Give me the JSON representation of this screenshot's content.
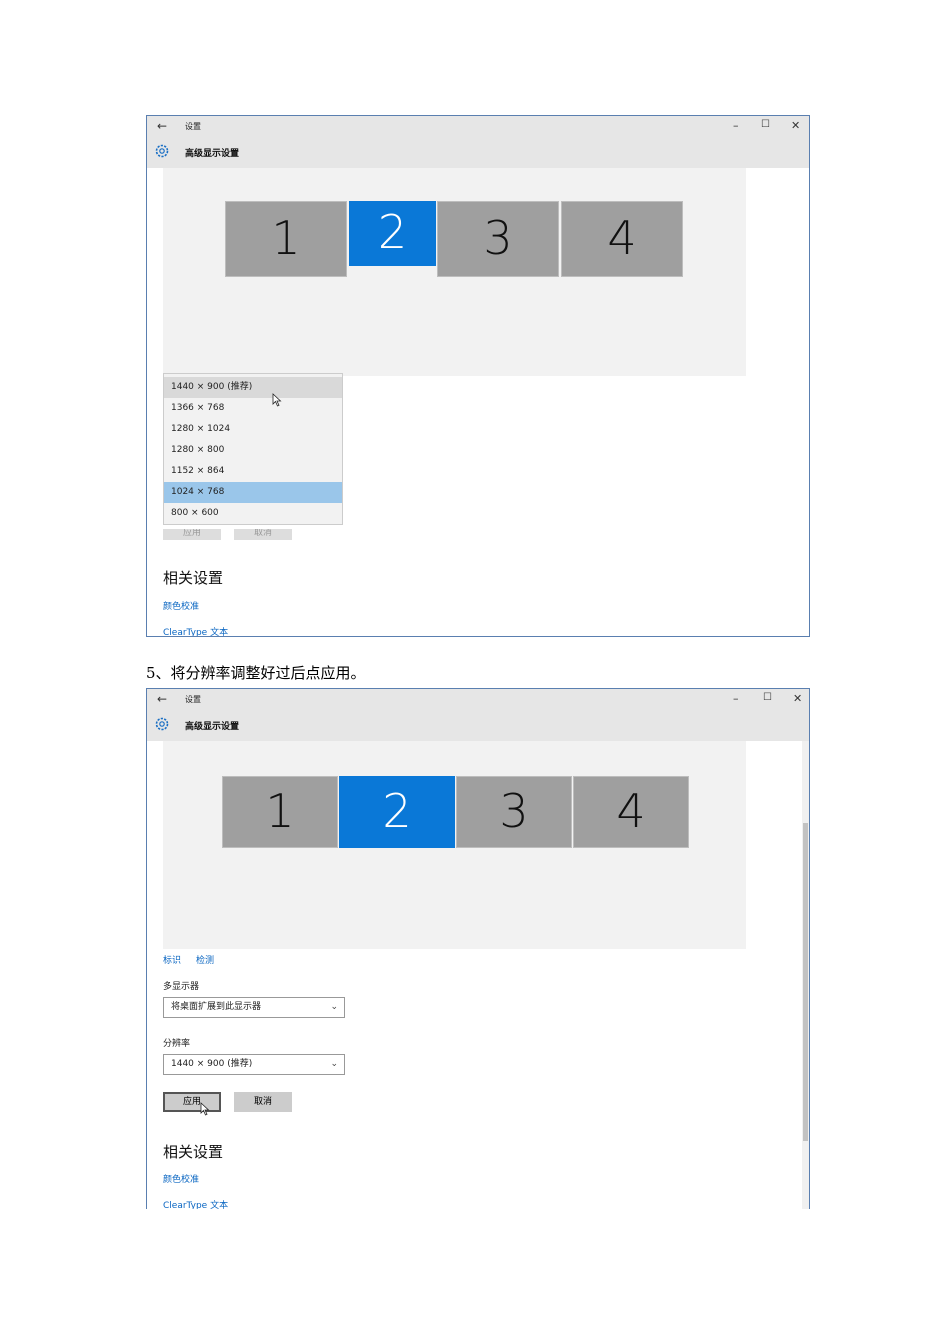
{
  "window1": {
    "back_glyph": "←",
    "app_title": "设置",
    "minimize": "–",
    "maximize": "☐",
    "close": "✕",
    "page_title": "高级显示设置",
    "monitors": [
      "1",
      "2",
      "3",
      "4"
    ],
    "selected_monitor": "2",
    "resolution_options": [
      "1440 × 900 (推荐)",
      "1366 × 768",
      "1280 × 1024",
      "1280 × 800",
      "1152 × 864",
      "1024 × 768",
      "800 × 600"
    ],
    "hovered_option": "1440 × 900 (推荐)",
    "selected_option": "1024 × 768",
    "apply_label": "应用",
    "cancel_label": "取消",
    "related_heading": "相关设置",
    "link_color": "颜色校准",
    "link_cleartype": "ClearType 文本"
  },
  "step_text": "5、将分辨率调整好过后点应用。",
  "window2": {
    "back_glyph": "←",
    "app_title": "设置",
    "minimize": "–",
    "maximize": "☐",
    "close": "✕",
    "page_title": "高级显示设置",
    "monitors": [
      "1",
      "2",
      "3",
      "4"
    ],
    "selected_monitor": "2",
    "identify_link": "标识",
    "detect_link": "检测",
    "multi_display_label": "多显示器",
    "multi_display_value": "将桌面扩展到此显示器",
    "resolution_label": "分辨率",
    "resolution_value": "1440 × 900 (推荐)",
    "apply_label": "应用",
    "cancel_label": "取消",
    "related_heading": "相关设置",
    "link_color": "颜色校准",
    "link_cleartype": "ClearType 文本"
  },
  "colors": {
    "accent": "#0a78d7",
    "titlebar": "#e6e6e6",
    "link": "#0a66c2",
    "dropdown_selected": "#9ac6ea"
  }
}
